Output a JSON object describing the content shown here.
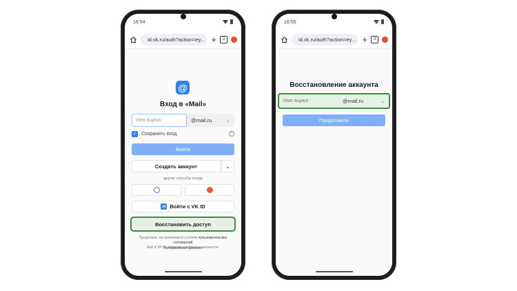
{
  "phone1": {
    "status": {
      "time": "16:54"
    },
    "browser": {
      "url": "id.vk.ru/auth?action=ey...",
      "tab_count": "3"
    },
    "page": {
      "title": "Вход в «Mail»",
      "email_placeholder": "Имя ящика",
      "domain": "@mail.ru",
      "save_login_label": "Сохранить вход",
      "login_button": "Войти",
      "create_account_button": "Создать аккаунт",
      "other_methods": "другие способы входа",
      "vk_id_button": "Войти с VK ID",
      "restore_button": "Восстановить доступ",
      "legal_prefix": "Продолжая, вы принимаете условия",
      "legal_link": "пользовательских соглашений",
      "legal_suffix": "Mail и VK ID, политику конфиденциальности.",
      "transfer_link": "Передаваемые данные"
    }
  },
  "phone2": {
    "status": {
      "time": "16:55"
    },
    "browser": {
      "url": "id.vk.ru/auth?action=ey...",
      "tab_count": "3"
    },
    "page": {
      "title": "Восстановление аккаунта",
      "email_placeholder": "Имя ящика",
      "domain": "@mail.ru",
      "continue_button": "Продолжить"
    }
  },
  "colors": {
    "accent": "#2d81f7",
    "highlight_border": "#3a8c3f",
    "highlight_fill": "#e5f1e5",
    "disabled_button": "#7fb0f7"
  }
}
